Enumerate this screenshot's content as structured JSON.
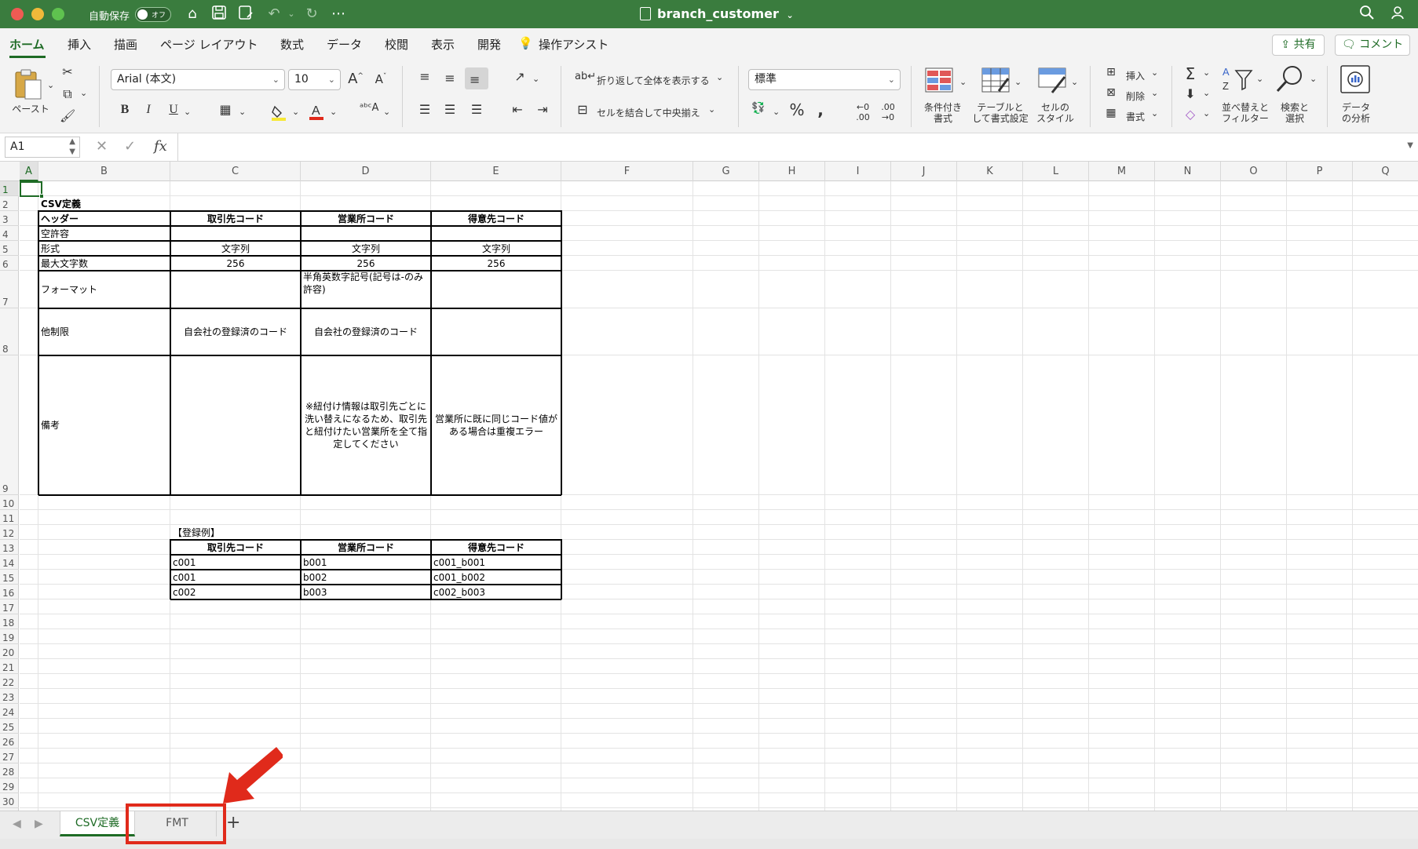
{
  "titlebar": {
    "autosave_label": "自動保存",
    "autosave_state": "オフ",
    "document_title": "branch_customer"
  },
  "ribbon_tabs": [
    "ホーム",
    "挿入",
    "描画",
    "ページ レイアウト",
    "数式",
    "データ",
    "校閲",
    "表示",
    "開発",
    "操作アシスト"
  ],
  "share_label": "共有",
  "comment_label": "コメント",
  "ribbon": {
    "paste_label": "ペースト",
    "font_name": "Arial (本文)",
    "font_size": "10",
    "bold": "B",
    "italic": "I",
    "underline": "U",
    "wrap_text": "折り返して全体を表示する",
    "merge_center": "セルを結合して中央揃え",
    "number_format": "標準",
    "cond_format": [
      "条件付き",
      "書式"
    ],
    "format_table": [
      "テーブルと",
      "して書式設定"
    ],
    "cell_styles": [
      "セルの",
      "スタイル"
    ],
    "insert": "挿入",
    "delete": "削除",
    "format": "書式",
    "sort_filter": [
      "並べ替えと",
      "フィルター"
    ],
    "find_select": [
      "検索と",
      "選択"
    ],
    "analyze": [
      "データ",
      "の分析"
    ]
  },
  "formula_bar": {
    "name_box": "A1",
    "fx": "fx"
  },
  "columns": [
    "A",
    "B",
    "C",
    "D",
    "E",
    "F",
    "G",
    "H",
    "I",
    "J",
    "K",
    "L",
    "M",
    "N",
    "O",
    "P",
    "Q"
  ],
  "rows": [
    "1",
    "2",
    "3",
    "4",
    "5",
    "6",
    "7",
    "8",
    "9",
    "10",
    "11",
    "12",
    "13",
    "14",
    "15",
    "16",
    "17",
    "18",
    "19",
    "20",
    "21",
    "22",
    "23",
    "24",
    "25",
    "26",
    "27",
    "28",
    "29",
    "30"
  ],
  "sheet": {
    "csv_title": "CSV定義",
    "def_table": {
      "headers": [
        "ヘッダー",
        "取引先コード",
        "営業所コード",
        "得意先コード"
      ],
      "rows": [
        {
          "label": "空許容",
          "c": "",
          "d": "",
          "e": ""
        },
        {
          "label": "形式",
          "c": "文字列",
          "d": "文字列",
          "e": "文字列"
        },
        {
          "label": "最大文字数",
          "c": "256",
          "d": "256",
          "e": "256"
        },
        {
          "label": "フォーマット",
          "c": "",
          "d": "半角英数字記号(記号は-のみ許容)",
          "e": ""
        },
        {
          "label": "他制限",
          "c": "自会社の登録済のコード",
          "d": "自会社の登録済のコード",
          "e": ""
        },
        {
          "label": "備考",
          "c": "",
          "d": "※紐付け情報は取引先ごとに洗い替えになるため、取引先と紐付けたい営業所を全て指定してください",
          "e": "営業所に既に同じコード値がある場合は重複エラー"
        }
      ]
    },
    "example_title": "【登録例】",
    "example_table": {
      "headers": [
        "取引先コード",
        "営業所コード",
        "得意先コード"
      ],
      "rows": [
        [
          "c001",
          "b001",
          "c001_b001"
        ],
        [
          "c001",
          "b002",
          "c001_b002"
        ],
        [
          "c002",
          "b003",
          "c002_b003"
        ]
      ]
    }
  },
  "sheet_tabs": [
    "CSV定義",
    "FMT"
  ],
  "colors": {
    "excel_green": "#3a7c3e",
    "accent_green": "#1e6b25",
    "annotation_red": "#e02a1b"
  }
}
